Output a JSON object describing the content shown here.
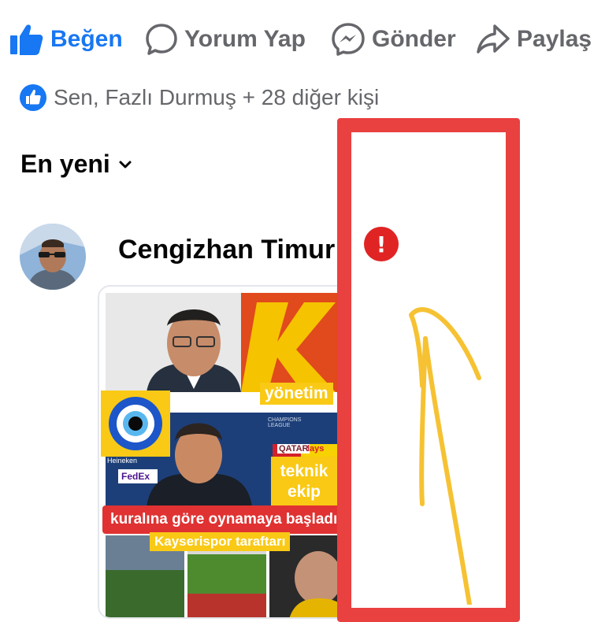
{
  "actions": {
    "like": "Beğen",
    "comment": "Yorum Yap",
    "send": "Gönder",
    "share": "Paylaş"
  },
  "reactions": {
    "summary": "Sen, Fazlı Durmuş + 28 diğer kişi"
  },
  "comments": {
    "sort_label": "En yeni"
  },
  "comment": {
    "author": "Cengizhan Timur",
    "image_labels": {
      "management": "yönetim",
      "tech_line1": "teknik",
      "tech_line2": "ekip",
      "banner": "kuralına göre oynamaya başladık",
      "fans": "Kayserispor taraftarı",
      "sponsor1": "QATAR",
      "sponsor2": "FedEx",
      "sponsor3": "Heineken",
      "sponsor4": "lays",
      "league": "CHAMPIONS LEAGUE"
    }
  },
  "overlay": {
    "alert_symbol": "!"
  },
  "colors": {
    "facebook_blue": "#1877f2",
    "icon_gray": "#65676b",
    "annotation_red": "#e94040",
    "annotation_yellow": "#f6c233"
  },
  "icons": [
    "thumbs-up-icon",
    "comment-bubble-icon",
    "messenger-icon",
    "share-arrow-icon",
    "like-badge-icon",
    "chevron-down-icon",
    "alert-icon",
    "evil-eye-icon"
  ]
}
